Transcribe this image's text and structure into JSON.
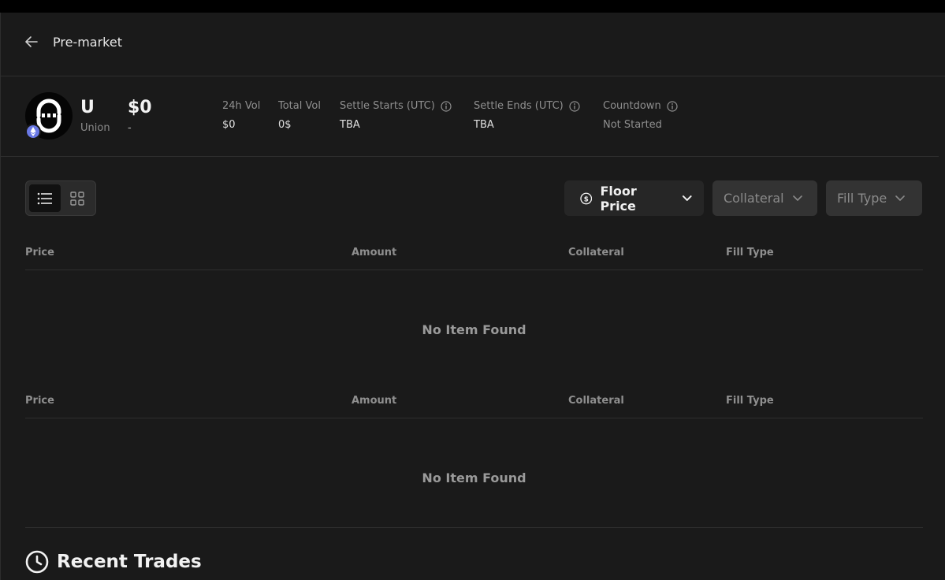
{
  "header": {
    "title": "Pre-market"
  },
  "token": {
    "symbol": "U",
    "name": "Union",
    "price": "$0",
    "change": "-"
  },
  "stats": [
    {
      "label": "24h Vol",
      "value": "$0"
    },
    {
      "label": "Total Vol",
      "value": "0$"
    },
    {
      "label": "Settle Starts (UTC)",
      "value": "TBA"
    },
    {
      "label": "Settle Ends (UTC)",
      "value": "TBA"
    },
    {
      "label": "Countdown",
      "value": "Not Started"
    }
  ],
  "filters": {
    "floor_price": "Floor Price",
    "collateral": "Collateral",
    "fill_type": "Fill Type"
  },
  "tables": [
    {
      "columns": [
        "Price",
        "Amount",
        "Collateral",
        "Fill Type"
      ],
      "empty_text": "No Item Found"
    },
    {
      "columns": [
        "Price",
        "Amount",
        "Collateral",
        "Fill Type"
      ],
      "empty_text": "No Item Found"
    }
  ],
  "recent": {
    "title": "Recent Trades"
  },
  "colors": {
    "background": "#1a1a1a",
    "chain_badge": "#6a79e6",
    "muted_text": "#8f8f8f"
  }
}
